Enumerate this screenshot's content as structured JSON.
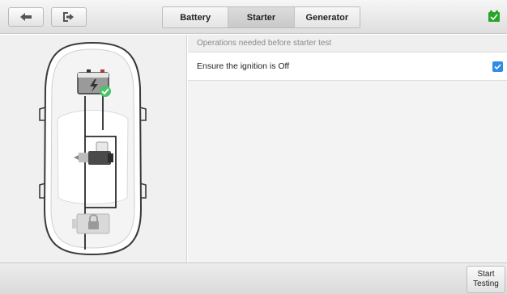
{
  "tabs": [
    {
      "label": "Battery",
      "active": false
    },
    {
      "label": "Starter",
      "active": true
    },
    {
      "label": "Generator",
      "active": false
    }
  ],
  "status": {
    "icon": "battery-ok-icon",
    "color": "#2aa52a"
  },
  "panel": {
    "header": "Operations needed before starter test",
    "items": [
      {
        "label": "Ensure the ignition is Off",
        "checked": true
      }
    ]
  },
  "footer": {
    "start_label": "Start\nTesting"
  },
  "diagram": {
    "icons": [
      "car-outline-icon",
      "battery-icon",
      "check-icon",
      "starter-motor-icon",
      "engine-lock-icon"
    ]
  },
  "colors": {
    "accent": "#2f8ce6",
    "check": "#4cc26a",
    "battery_ok": "#2aa52a"
  }
}
